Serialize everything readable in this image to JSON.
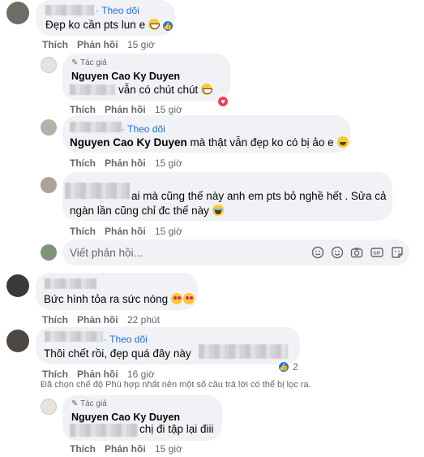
{
  "comment1": {
    "follow": "· Theo dõi",
    "text": "Đẹp ko cần pts lun e",
    "like": "Thích",
    "reply": "Phản hồi",
    "time": "15 giờ"
  },
  "reply1": {
    "author_badge": "Tác giả",
    "name": "Nguyen Cao Ky Duyen",
    "text": "vẫn có chút chút",
    "like": "Thích",
    "reply": "Phản hồi",
    "time": "15 giờ"
  },
  "reply2": {
    "follow": "· Theo dõi",
    "tag": "Nguyen Cao Ky Duyen",
    "text": "mà thật vẫn đẹp ko có bị ảo e",
    "like": "Thích",
    "reply": "Phản hồi",
    "time": "15 giờ"
  },
  "reply3": {
    "text_line1": "ai mà cũng thế này anh em pts bỏ nghề hết . Sửa cả",
    "text_line2": "ngàn lần cũng chỉ đc thế này",
    "like": "Thích",
    "reply": "Phản hồi",
    "time": "15 giờ"
  },
  "reply_input": {
    "placeholder": "Viết phản hồi..."
  },
  "comment2": {
    "text": "Bức hình tỏa ra sức nóng",
    "like": "Thích",
    "reply": "Phản hồi",
    "time": "22 phút"
  },
  "comment3": {
    "follow": "· Theo dõi",
    "text": "Thôi chết rồi, đẹp quá đây này",
    "like_count": "2",
    "like": "Thích",
    "reply": "Phản hồi",
    "time": "16 giờ"
  },
  "filter_notice": "Đã chọn chế độ Phù hợp nhất nên một số câu trả lời có thể bị lọc ra.",
  "reply4": {
    "author_badge": "Tác giả",
    "name": "Nguyen Cao Ky Duyen",
    "text": "chị đi tập lại điii",
    "like": "Thích",
    "reply": "Phản hồi",
    "time": "15 giờ"
  },
  "colors": {
    "link": "#216fdb",
    "bubble": "#f0f2f5",
    "meta": "#65676b",
    "like_blue": "#1877f2",
    "heart_red": "#f33e58"
  }
}
